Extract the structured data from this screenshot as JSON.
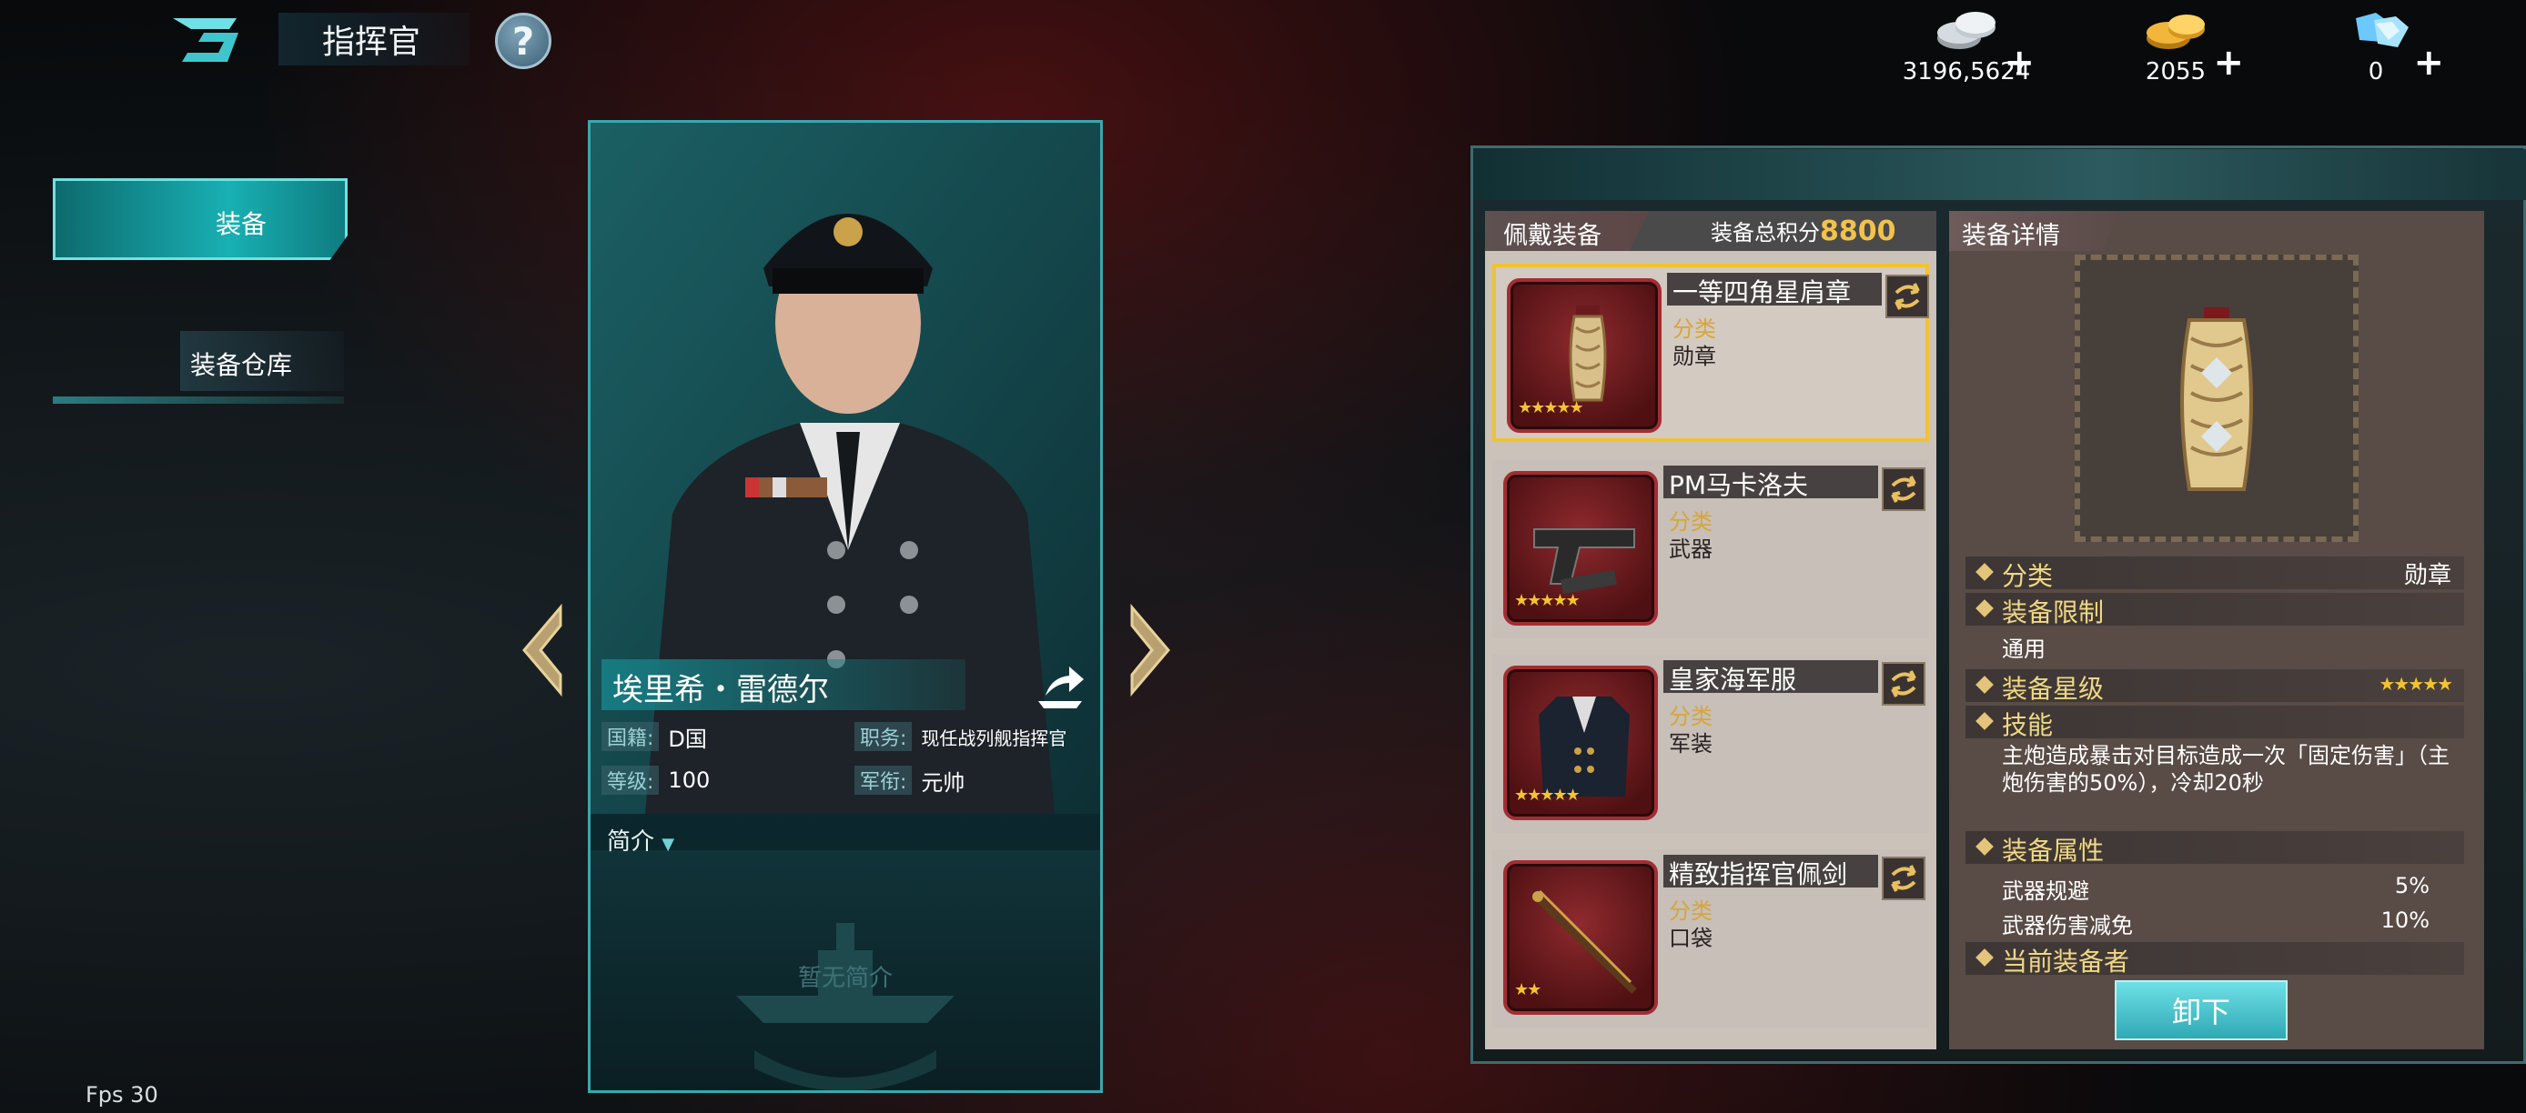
{
  "header": {
    "title": "指挥官",
    "help_label": "?"
  },
  "resources": [
    {
      "icon": "silver-coins-icon",
      "value": "3196,5624"
    },
    {
      "icon": "gold-coins-icon",
      "value": "2055"
    },
    {
      "icon": "diamond-icon",
      "value": "0"
    }
  ],
  "nav": {
    "equip": "装备",
    "storehouse": "装备仓库"
  },
  "commander": {
    "name": "埃里希・雷德尔",
    "nationality_key": "国籍:",
    "nationality": "D国",
    "position_key": "职务:",
    "position": "现任战列舰指挥官",
    "level_key": "等级:",
    "level": "100",
    "rank_key": "军衔:",
    "rank": "元帅",
    "intro_label": "简介",
    "intro_empty": "暂无简介"
  },
  "worn": {
    "title": "佩戴装备",
    "score_label": "装备总积分",
    "score": "8800",
    "category_key": "分类",
    "items": [
      {
        "name": "一等四角星肩章",
        "category": "勋章",
        "stars": "★★★★★"
      },
      {
        "name": "PM马卡洛夫",
        "category": "武器",
        "stars": "★★★★★"
      },
      {
        "name": "皇家海军服",
        "category": "军装",
        "stars": "★★★★★"
      },
      {
        "name": "精致指挥官佩剑",
        "category": "口袋",
        "stars": "★★"
      }
    ]
  },
  "detail": {
    "title": "装备详情",
    "category_key": "分类",
    "category_val": "勋章",
    "limit_key": "装备限制",
    "limit_val": "通用",
    "star_key": "装备星级",
    "star_val": "★★★★★",
    "skill_key": "技能",
    "skill_text": "主炮造成暴击对目标造成一次「固定伤害」（主炮伤害的50%），冷却20秒",
    "attr_key": "装备属性",
    "attrs": [
      {
        "name": "武器规避",
        "value": "5%"
      },
      {
        "name": "武器伤害减免",
        "value": "10%"
      }
    ],
    "holder_key": "当前装备者",
    "unequip_label": "卸下"
  },
  "fps": "Fps 30",
  "colors": {
    "accent_teal": "#18b0b3",
    "gold": "#f4c430",
    "selected_border": "#f1c232"
  }
}
